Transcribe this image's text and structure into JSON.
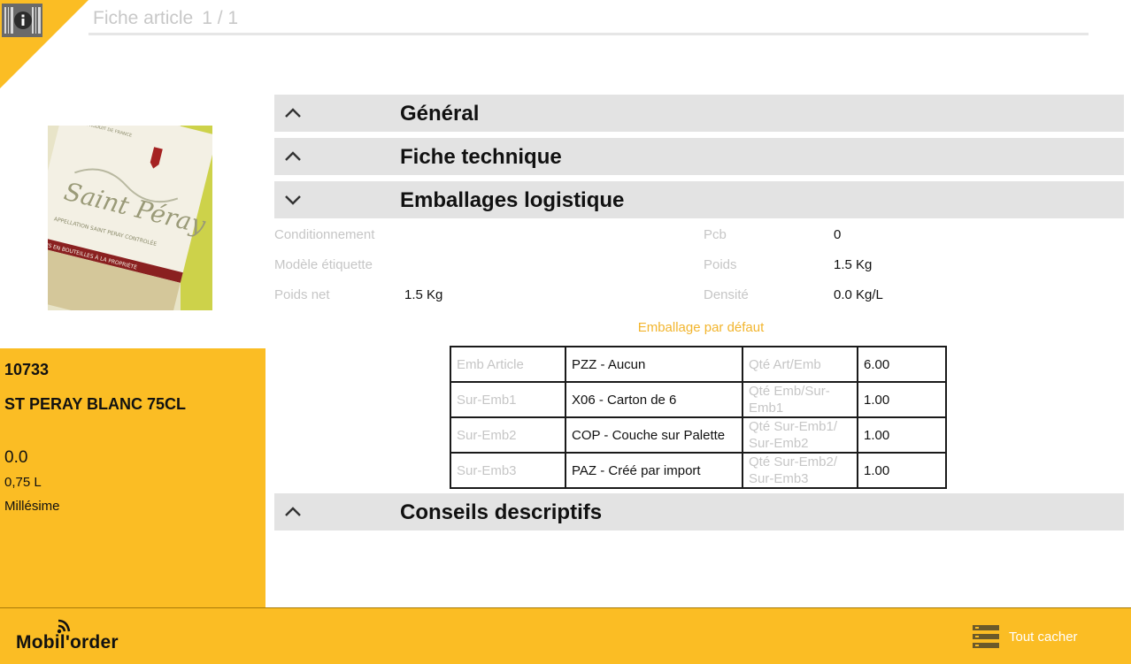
{
  "header": {
    "title": "Fiche article",
    "count": "1 / 1"
  },
  "product": {
    "code": "10733",
    "name": "ST PERAY BLANC 75CL",
    "price": "0.0",
    "volume": "0,75 L",
    "vintage_label": "Millésime",
    "image_text": {
      "brand": "Saint Péray",
      "appellation": "APPELLATION SAINT PERAY CONTROLÉE",
      "origin": "PRODUIT DE FRANCE",
      "bottled": "MIS EN BOUTEILLES À LA PROPRIÉTÉ"
    }
  },
  "sections": {
    "general": "Général",
    "technical": "Fiche technique",
    "packaging": "Emballages logistique",
    "advice": "Conseils descriptifs"
  },
  "packaging": {
    "conditionnement_label": "Conditionnement",
    "modele_label": "Modèle étiquette",
    "poids_net_label": "Poids net",
    "poids_net_value": "1.5 Kg",
    "pcb_label": "Pcb",
    "pcb_value": "0",
    "poids_label": "Poids",
    "poids_value": "1.5 Kg",
    "densite_label": "Densité",
    "densite_value": "0.0 Kg/L",
    "default_caption": "Emballage par défaut",
    "table": [
      {
        "key1": "Emb Article",
        "val1": "PZZ - Aucun",
        "key2": "Qté Art/Emb",
        "val2": "6.00"
      },
      {
        "key1": "Sur-Emb1",
        "val1": "X06 - Carton de 6",
        "key2": "Qté Emb/Sur-Emb1",
        "val2": "1.00"
      },
      {
        "key1": "Sur-Emb2",
        "val1": "COP - Couche sur Palette",
        "key2": "Qté Sur-Emb1/ Sur-Emb2",
        "val2": "1.00"
      },
      {
        "key1": "Sur-Emb3",
        "val1": "PAZ - Créé par import",
        "key2": "Qté Sur-Emb2/ Sur-Emb3",
        "val2": "1.00"
      }
    ]
  },
  "footer": {
    "logo": "Mobil'order",
    "hide_all": "Tout cacher"
  },
  "colors": {
    "accent": "#fbbd24",
    "section_bg": "#e3e3e3",
    "label": "#c6c6c6",
    "caption": "#f2b52e"
  },
  "icons": {
    "info": "info-icon",
    "collapse": "chevron-up-icon",
    "expand": "chevron-down-icon",
    "hide_all": "list-icon"
  }
}
